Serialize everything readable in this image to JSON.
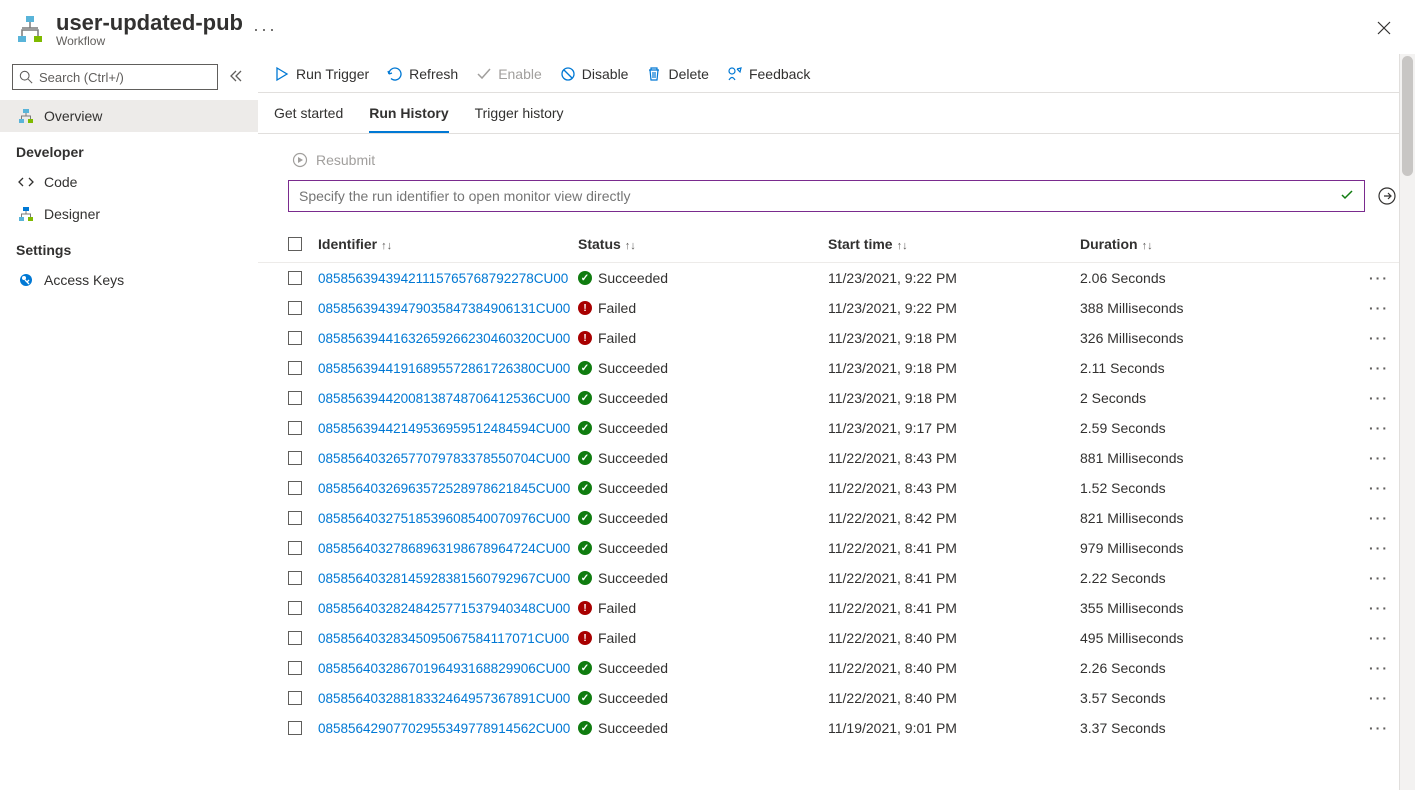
{
  "header": {
    "title": "user-updated-pub",
    "subtitle": "Workflow"
  },
  "sidebar": {
    "search_placeholder": "Search (Ctrl+/)",
    "items": [
      {
        "label": "Overview",
        "active": true,
        "icon": "workflow"
      }
    ],
    "sections": [
      {
        "title": "Developer",
        "items": [
          {
            "label": "Code",
            "icon": "code"
          },
          {
            "label": "Designer",
            "icon": "designer"
          }
        ]
      },
      {
        "title": "Settings",
        "items": [
          {
            "label": "Access Keys",
            "icon": "key"
          }
        ]
      }
    ]
  },
  "toolbar": {
    "run_trigger": "Run Trigger",
    "refresh": "Refresh",
    "enable": "Enable",
    "disable": "Disable",
    "delete": "Delete",
    "feedback": "Feedback"
  },
  "tabs": [
    {
      "label": "Get started",
      "active": false
    },
    {
      "label": "Run History",
      "active": true
    },
    {
      "label": "Trigger history",
      "active": false
    }
  ],
  "content_area": {
    "resubmit_label": "Resubmit",
    "filter_placeholder": "Specify the run identifier to open monitor view directly"
  },
  "table": {
    "columns": {
      "identifier": "Identifier",
      "status": "Status",
      "start_time": "Start time",
      "duration": "Duration"
    },
    "rows": [
      {
        "id": "08585639439421115765768792278CU00",
        "status": "Succeeded",
        "ok": true,
        "start": "11/23/2021, 9:22 PM",
        "dur": "2.06 Seconds"
      },
      {
        "id": "08585639439479035847384906131CU00",
        "status": "Failed",
        "ok": false,
        "start": "11/23/2021, 9:22 PM",
        "dur": "388 Milliseconds"
      },
      {
        "id": "08585639441632659266230460320CU00",
        "status": "Failed",
        "ok": false,
        "start": "11/23/2021, 9:18 PM",
        "dur": "326 Milliseconds"
      },
      {
        "id": "08585639441916895572861726380CU00",
        "status": "Succeeded",
        "ok": true,
        "start": "11/23/2021, 9:18 PM",
        "dur": "2.11 Seconds"
      },
      {
        "id": "08585639442008138748706412536CU00",
        "status": "Succeeded",
        "ok": true,
        "start": "11/23/2021, 9:18 PM",
        "dur": "2 Seconds"
      },
      {
        "id": "08585639442149536959512484594CU00",
        "status": "Succeeded",
        "ok": true,
        "start": "11/23/2021, 9:17 PM",
        "dur": "2.59 Seconds"
      },
      {
        "id": "08585640326577079783378550704CU00",
        "status": "Succeeded",
        "ok": true,
        "start": "11/22/2021, 8:43 PM",
        "dur": "881 Milliseconds"
      },
      {
        "id": "08585640326963572528978621845CU00",
        "status": "Succeeded",
        "ok": true,
        "start": "11/22/2021, 8:43 PM",
        "dur": "1.52 Seconds"
      },
      {
        "id": "08585640327518539608540070976CU00",
        "status": "Succeeded",
        "ok": true,
        "start": "11/22/2021, 8:42 PM",
        "dur": "821 Milliseconds"
      },
      {
        "id": "08585640327868963198678964724CU00",
        "status": "Succeeded",
        "ok": true,
        "start": "11/22/2021, 8:41 PM",
        "dur": "979 Milliseconds"
      },
      {
        "id": "08585640328145928381560792967CU00",
        "status": "Succeeded",
        "ok": true,
        "start": "11/22/2021, 8:41 PM",
        "dur": "2.22 Seconds"
      },
      {
        "id": "08585640328248425771537940348CU00",
        "status": "Failed",
        "ok": false,
        "start": "11/22/2021, 8:41 PM",
        "dur": "355 Milliseconds"
      },
      {
        "id": "08585640328345095067584117071CU00",
        "status": "Failed",
        "ok": false,
        "start": "11/22/2021, 8:40 PM",
        "dur": "495 Milliseconds"
      },
      {
        "id": "08585640328670196493168829906CU00",
        "status": "Succeeded",
        "ok": true,
        "start": "11/22/2021, 8:40 PM",
        "dur": "2.26 Seconds"
      },
      {
        "id": "08585640328818332464957367891CU00",
        "status": "Succeeded",
        "ok": true,
        "start": "11/22/2021, 8:40 PM",
        "dur": "3.57 Seconds"
      },
      {
        "id": "08585642907702955349778914562CU00",
        "status": "Succeeded",
        "ok": true,
        "start": "11/19/2021, 9:01 PM",
        "dur": "3.37 Seconds"
      }
    ]
  }
}
